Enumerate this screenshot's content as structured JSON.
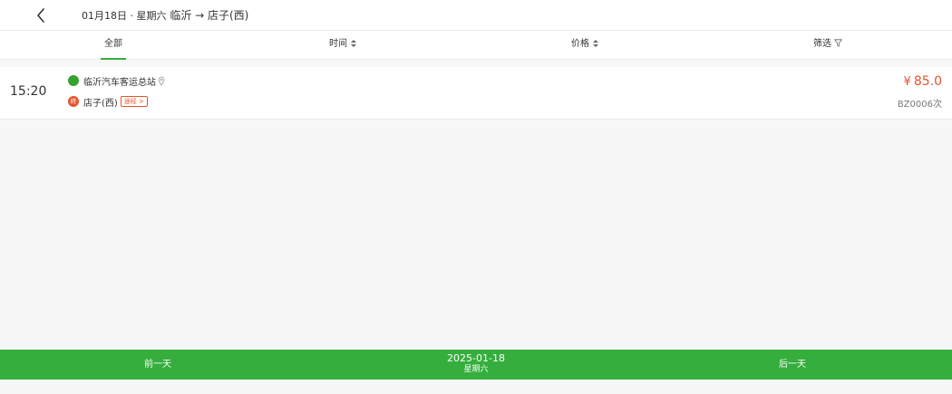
{
  "header": {
    "date_text": "01月18日 · 星期六",
    "route_text": "临沂 → 店子(西)"
  },
  "filters": {
    "all": "全部",
    "time": "时间",
    "price": "价格",
    "screen": "筛选"
  },
  "trips": [
    {
      "time": "15:20",
      "from": "临沂汽车客运总站",
      "to": "店子(西)",
      "end_marker": "终",
      "via_label": "途经 >",
      "price_symbol": "¥",
      "price": "85.0",
      "bus_no": "BZ0006次"
    }
  ],
  "bottom": {
    "prev_label": "前一天",
    "date": "2025-01-18",
    "weekday": "星期六",
    "next_label": "后一天"
  },
  "colors": {
    "accent": "#35ae3d",
    "price": "#e5532b"
  }
}
